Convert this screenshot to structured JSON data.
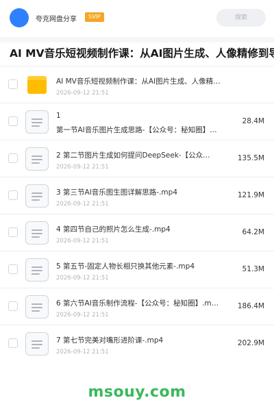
{
  "header": {
    "share_name": "夸克网盘分享",
    "badge": "SVIP",
    "search_placeholder": "搜索"
  },
  "folder_title": "AI MV音乐短视频制作课：从AI图片生成、人像精修到导演",
  "files": [
    {
      "type": "folder",
      "name": "AI MV音乐短视频制作课：从AI图片生成、人像精…",
      "date": "2026-09-12 21:51",
      "size": ""
    },
    {
      "type": "file",
      "name": "1",
      "name2": "第一节AI音乐图片生成思路-【公众号：秘知圈】…",
      "date": "2026-09-12 21:51",
      "size": "28.4M"
    },
    {
      "type": "file",
      "name": "2 第二节图片生成如何提问DeepSeek-【公众…",
      "date": "2026-09-12 21:51",
      "size": "135.5M"
    },
    {
      "type": "file",
      "name": "3 第三节AI音乐图生图详解思路-.mp4",
      "date": "2026-09-12 21:51",
      "size": "121.9M"
    },
    {
      "type": "file",
      "name": "4 第四节自己的照片怎么生成-.mp4",
      "date": "2026-09-12 21:51",
      "size": "64.2M"
    },
    {
      "type": "file",
      "name": "5 第五节-固定人物长相只换其他元素-.mp4",
      "date": "2026-09-12 21:51",
      "size": "51.3M"
    },
    {
      "type": "file",
      "name": "6 第六节AI音乐制作流程-【公众号：秘知圈】.m…",
      "date": "2026-09-12 21:51",
      "size": "186.4M"
    },
    {
      "type": "file",
      "name": "7 第七节完美对嘴形进阶课-.mp4",
      "date": "2026-09-12 21:51",
      "size": "202.9M"
    }
  ],
  "watermark": "msouy.com",
  "colors": {
    "accent": "#2f80ff",
    "svip": "#f5a623",
    "folder": "#ffbc00",
    "watermark": "#3cb85c"
  }
}
